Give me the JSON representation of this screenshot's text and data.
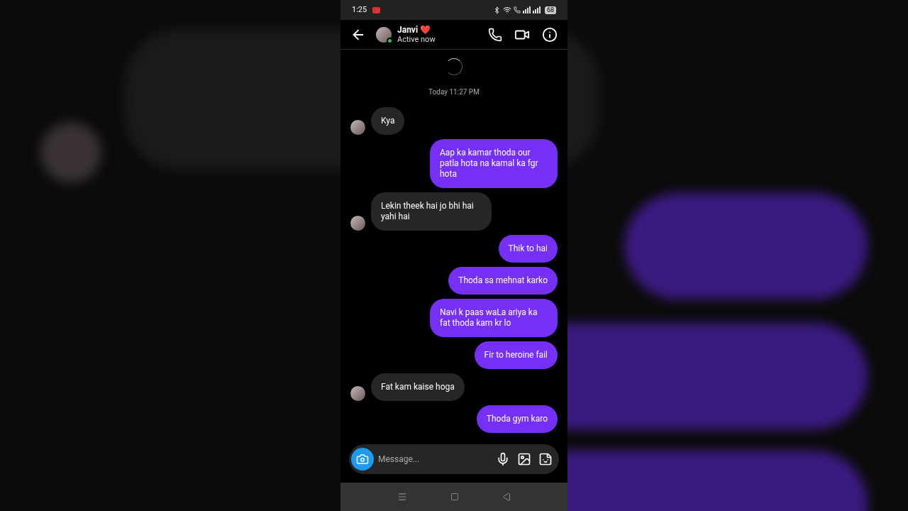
{
  "status_bar": {
    "time": "1:25",
    "battery": "68"
  },
  "header": {
    "name": "Janvi ❤️",
    "status": "Active now",
    "online": true
  },
  "timestamp": "Today 11:27 PM",
  "messages": [
    {
      "kind": "received",
      "text": "Kya"
    },
    {
      "kind": "sent",
      "text": "Aap ka kamar thoda our patla hota na kamal ka fgr hota"
    },
    {
      "kind": "received",
      "text": "Lekin theek hai jo bhi hai yahi hai"
    },
    {
      "kind": "sent",
      "text": "Thik to hai"
    },
    {
      "kind": "sent",
      "text": "Thoda sa mehnat karko"
    },
    {
      "kind": "sent",
      "text": "Navi k paas waLa ariya ka fat thoda kam kr lo"
    },
    {
      "kind": "sent",
      "text": "Fir to heroine fail"
    },
    {
      "kind": "received",
      "text": "Fat kam kaise hoga"
    },
    {
      "kind": "sent",
      "text": "Thoda gym karo"
    }
  ],
  "composer": {
    "placeholder": "Message..."
  }
}
